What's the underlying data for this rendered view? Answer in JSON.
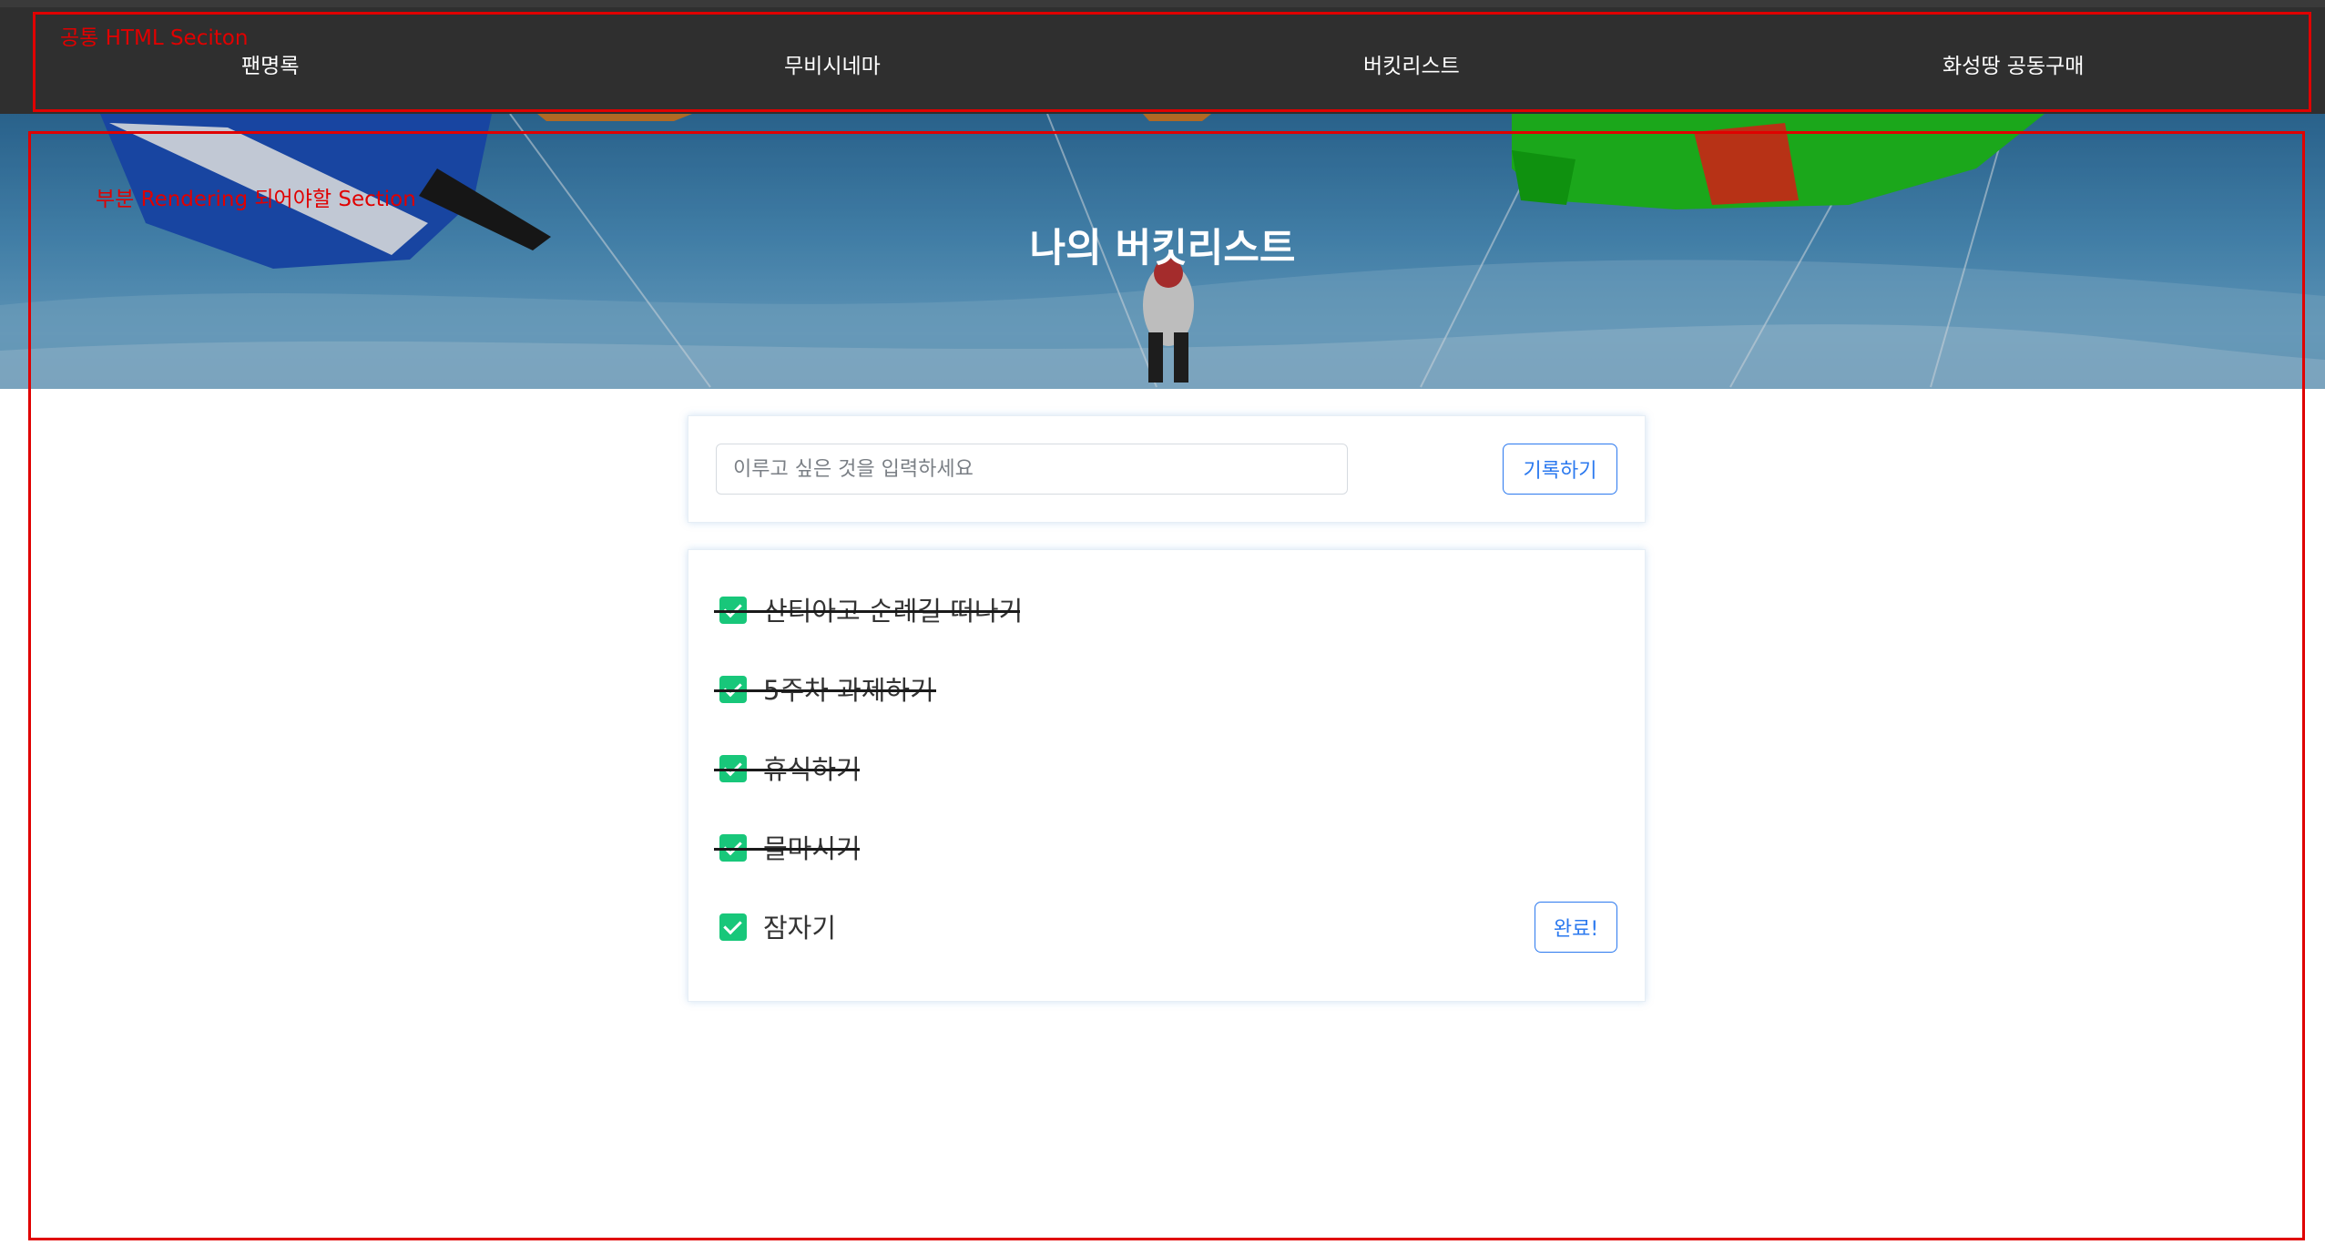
{
  "annotations": {
    "common_section_label": "공통 HTML Seciton",
    "partial_section_label": "부분 Rendering 되어야할 Section"
  },
  "nav": {
    "items": [
      "팬명록",
      "무비시네마",
      "버킷리스트",
      "화성땅 공동구매"
    ]
  },
  "hero": {
    "title": "나의 버킷리스트"
  },
  "form": {
    "input_placeholder": "이루고 싶은 것을 입력하세요",
    "input_value": "",
    "submit_label": "기록하기"
  },
  "bucket_list": {
    "items": [
      {
        "text": "산티아고 순례길 떠나기",
        "done": true
      },
      {
        "text": "5주차 과제하기",
        "done": true
      },
      {
        "text": "휴식하기",
        "done": true
      },
      {
        "text": "물마시기",
        "done": true
      },
      {
        "text": "잠자기",
        "done": false
      }
    ],
    "complete_button_label": "완료!"
  },
  "colors": {
    "navbar_bg": "#2f2f2f",
    "check_green": "#18c77a",
    "button_blue": "#2b79ef",
    "annotation_red": "#e00000"
  }
}
